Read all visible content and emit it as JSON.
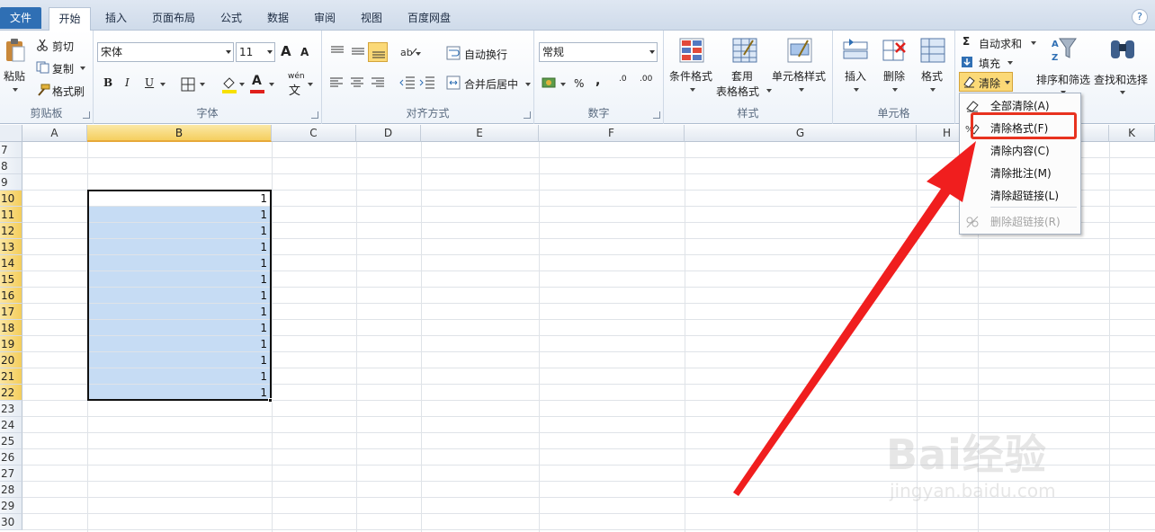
{
  "tabs": [
    "文件",
    "开始",
    "插入",
    "页面布局",
    "公式",
    "数据",
    "审阅",
    "视图",
    "百度网盘"
  ],
  "clipboard": {
    "paste": "粘贴",
    "cut": "剪切",
    "copy": "复制",
    "format_painter": "格式刷",
    "label": "剪贴板"
  },
  "font": {
    "name": "宋体",
    "size": "11",
    "label": "字体",
    "bold": "B",
    "italic": "I",
    "underline": "U",
    "grow": "A",
    "shrink": "A",
    "color_a": "A",
    "phonetic": "wén"
  },
  "alignment": {
    "wrap": "自动换行",
    "merge": "合并后居中",
    "label": "对齐方式"
  },
  "number": {
    "format": "常规",
    "percent": "%",
    "comma": ",",
    "inc": ".0",
    "dec": ".00",
    "label": "数字"
  },
  "styles": {
    "conditional": "条件格式",
    "table1": "套用",
    "table2": "表格格式",
    "cell": "单元格样式",
    "label": "样式"
  },
  "cells": {
    "insert": "插入",
    "delete": "删除",
    "format": "格式",
    "label": "单元格"
  },
  "editing": {
    "autosum": "自动求和",
    "fill": "填充",
    "clear": "清除",
    "sort": "排序和筛选",
    "find": "查找和选择"
  },
  "menu": {
    "items": [
      {
        "label": "全部清除(A)",
        "disabled": false
      },
      {
        "label": "清除格式(F)",
        "disabled": false
      },
      {
        "label": "清除内容(C)",
        "disabled": false
      },
      {
        "label": "清除批注(M)",
        "disabled": false
      },
      {
        "label": "清除超链接(L)",
        "disabled": false
      },
      {
        "label": "删除超链接(R)",
        "disabled": true
      }
    ]
  },
  "columns": [
    "A",
    "B",
    "C",
    "D",
    "E",
    "F",
    "G",
    "H",
    "",
    "K"
  ],
  "rows": [
    "7",
    "8",
    "9",
    "10",
    "11",
    "12",
    "13",
    "14",
    "15",
    "16",
    "17",
    "18",
    "19",
    "20",
    "21",
    "22",
    "23",
    "24",
    "25",
    "26",
    "27",
    "28",
    "29",
    "30"
  ],
  "cell_value": "1",
  "selected_column": "B",
  "selected_rows": [
    "10",
    "11",
    "12",
    "13",
    "14",
    "15",
    "16",
    "17",
    "18",
    "19",
    "20",
    "21",
    "22"
  ],
  "watermark": {
    "brand": "Bai经验",
    "url": "jingyan.baidu.com"
  }
}
